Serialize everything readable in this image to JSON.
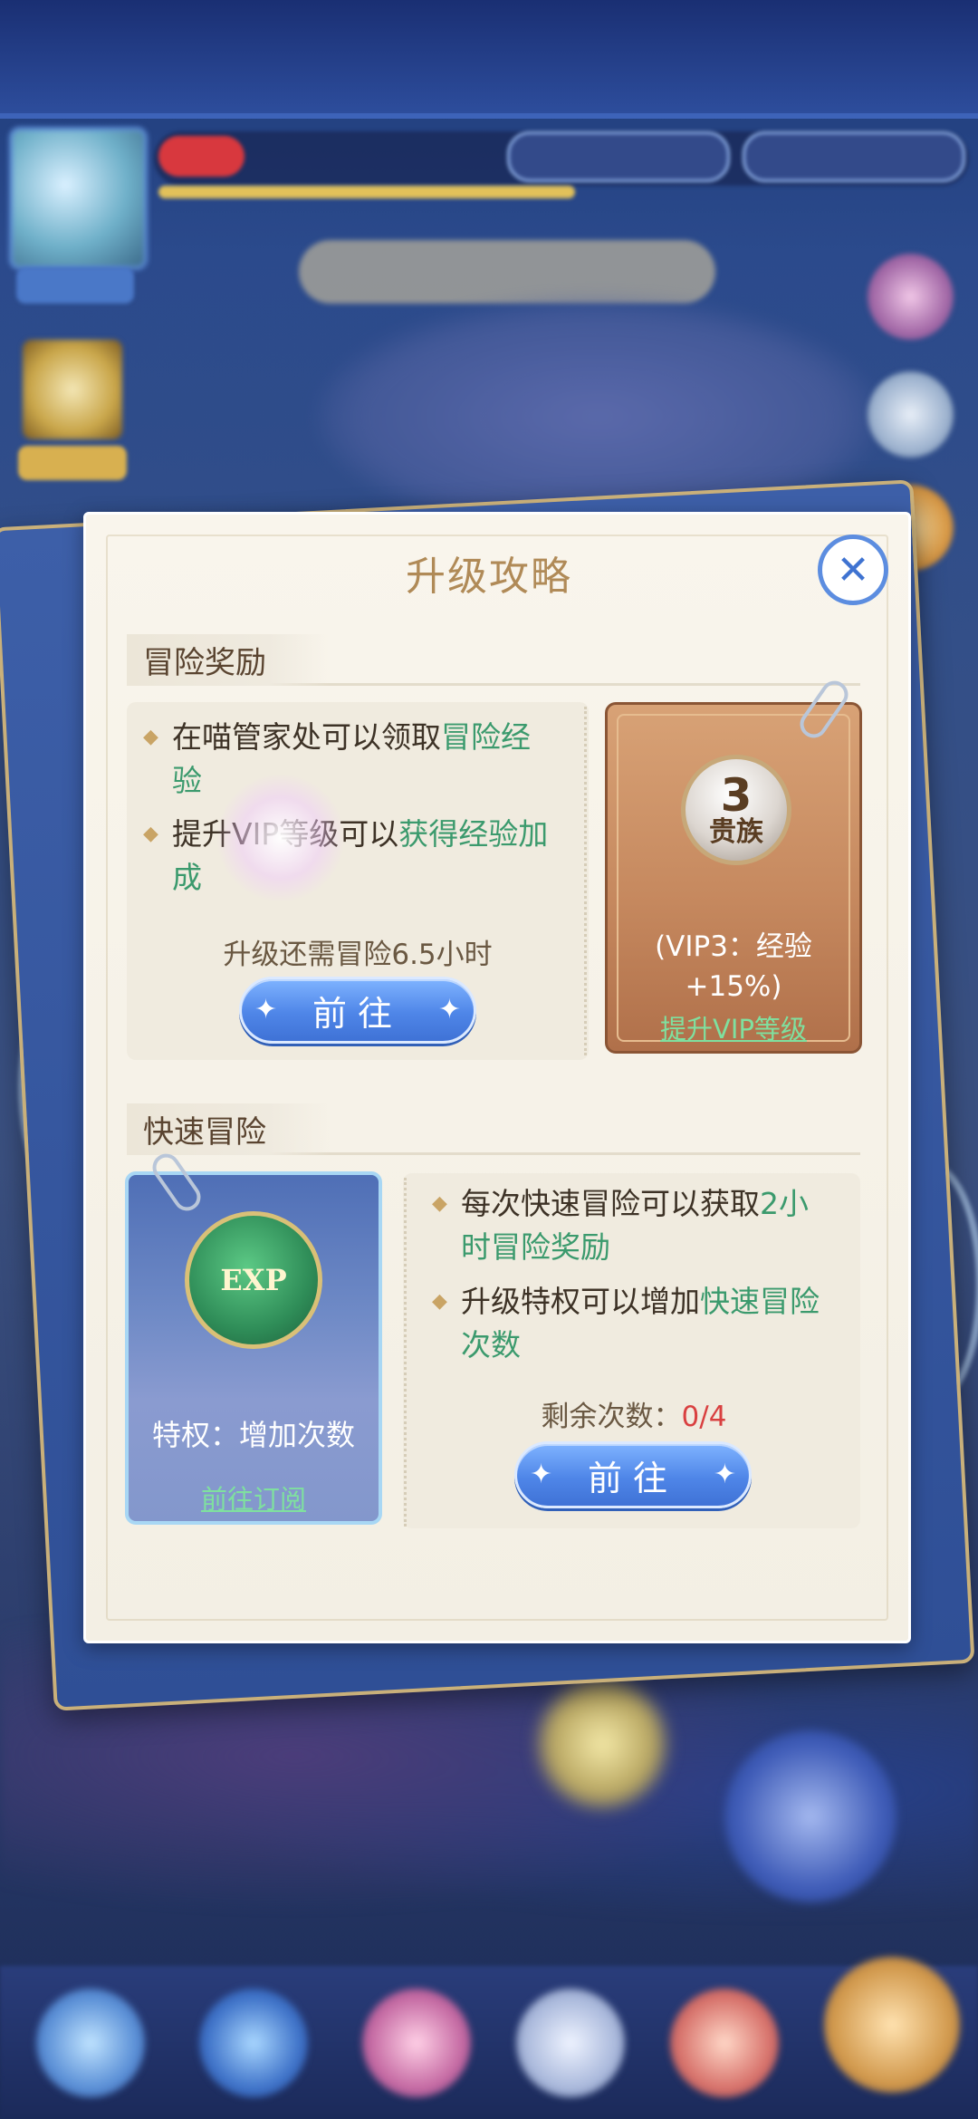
{
  "dialog": {
    "title": "升级攻略",
    "close_label": "✕"
  },
  "adventure_reward": {
    "header": "冒险奖励",
    "bullet1_text": "在喵管家处可以领取",
    "bullet1_green": "冒险经验",
    "bullet2_pre": "提升VIP等级可以",
    "bullet2_green": "获得经验加成",
    "note": "升级还需冒险6.5小时",
    "go_button": "前往"
  },
  "vip_card": {
    "level_num": "3",
    "rank_label": "贵族",
    "desc_line1": "(VIP3：经验",
    "desc_line2": "+15%)",
    "link": "提升VIP等级"
  },
  "quick_adventure": {
    "header": "快速冒险",
    "bullet1_pre": "每次快速冒险可以获取",
    "bullet1_green": "2小时冒险奖励",
    "bullet2_pre": "升级特权可以增加",
    "bullet2_green": "快速冒险次数",
    "remaining_label": "剩余次数：",
    "remaining_value": "0/4",
    "go_button": "前往"
  },
  "exp_card": {
    "badge_text": "EXP",
    "desc": "特权：增加次数",
    "link": "前往订阅"
  },
  "colors": {
    "accent_blue": "#4f86e8",
    "green_text": "#3b9a6d",
    "red_text": "#d94040",
    "title_gold": "#b08a57"
  }
}
